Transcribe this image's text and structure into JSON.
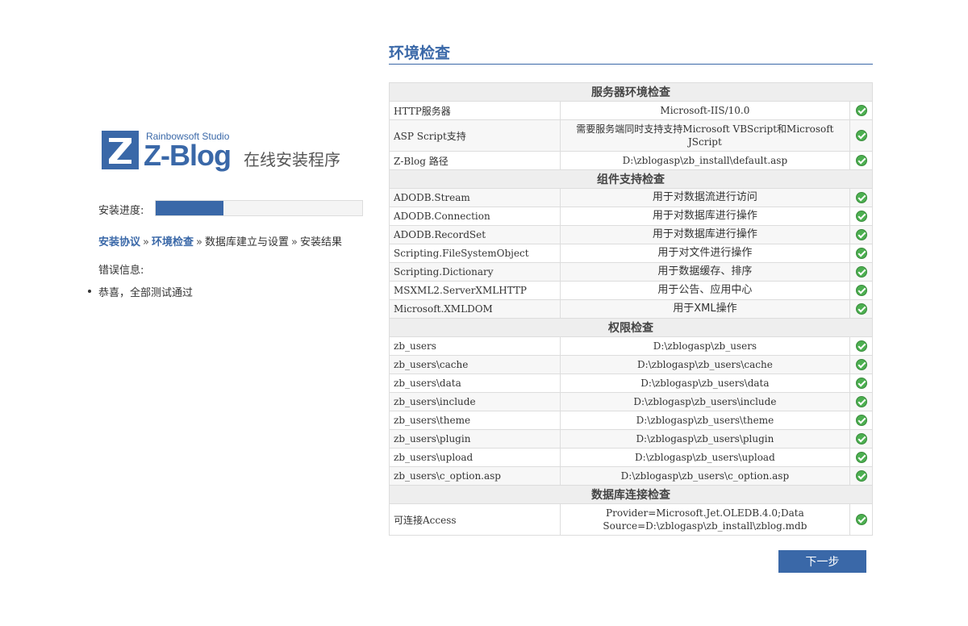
{
  "logo": {
    "studio": "Rainbowsoft Studio",
    "brand": "Z-Blog",
    "subtitle": "在线安装程序"
  },
  "progress": {
    "label": "安装进度:",
    "percent": 33
  },
  "steps": [
    {
      "label": "安装协议",
      "done": true
    },
    {
      "label": "环境检查",
      "done": true
    },
    {
      "label": "数据库建立与设置",
      "done": false
    },
    {
      "label": "安装结果",
      "done": false
    }
  ],
  "step_separator": "»",
  "error": {
    "label": "错误信息:",
    "messages": [
      "恭喜，全部测试通过"
    ]
  },
  "page_title": "环境检查",
  "sections": [
    {
      "title": "服务器环境检查",
      "rows": [
        {
          "name": "HTTP服务器",
          "value": "Microsoft-IIS/10.0",
          "status": "ok"
        },
        {
          "name": "ASP Script支持",
          "value": "需要服务端同时支持支持Microsoft VBScript和Microsoft JScript",
          "status": "ok"
        },
        {
          "name": "Z-Blog 路径",
          "value": "D:\\zblogasp\\zb_install\\default.asp",
          "status": "ok"
        }
      ]
    },
    {
      "title": "组件支持检查",
      "rows": [
        {
          "name": "ADODB.Stream",
          "value": "用于对数据流进行访问",
          "status": "ok"
        },
        {
          "name": "ADODB.Connection",
          "value": "用于对数据库进行操作",
          "status": "ok"
        },
        {
          "name": "ADODB.RecordSet",
          "value": "用于对数据库进行操作",
          "status": "ok"
        },
        {
          "name": "Scripting.FileSystemObject",
          "value": "用于对文件进行操作",
          "status": "ok"
        },
        {
          "name": "Scripting.Dictionary",
          "value": "用于数据缓存、排序",
          "status": "ok"
        },
        {
          "name": "MSXML2.ServerXMLHTTP",
          "value": "用于公告、应用中心",
          "status": "ok"
        },
        {
          "name": "Microsoft.XMLDOM",
          "value": "用于XML操作",
          "status": "ok"
        }
      ]
    },
    {
      "title": "权限检查",
      "rows": [
        {
          "name": "zb_users",
          "value": "D:\\zblogasp\\zb_users",
          "status": "ok"
        },
        {
          "name": "zb_users\\cache",
          "value": "D:\\zblogasp\\zb_users\\cache",
          "status": "ok"
        },
        {
          "name": "zb_users\\data",
          "value": "D:\\zblogasp\\zb_users\\data",
          "status": "ok"
        },
        {
          "name": "zb_users\\include",
          "value": "D:\\zblogasp\\zb_users\\include",
          "status": "ok"
        },
        {
          "name": "zb_users\\theme",
          "value": "D:\\zblogasp\\zb_users\\theme",
          "status": "ok"
        },
        {
          "name": "zb_users\\plugin",
          "value": "D:\\zblogasp\\zb_users\\plugin",
          "status": "ok"
        },
        {
          "name": "zb_users\\upload",
          "value": "D:\\zblogasp\\zb_users\\upload",
          "status": "ok"
        },
        {
          "name": "zb_users\\c_option.asp",
          "value": "D:\\zblogasp\\zb_users\\c_option.asp",
          "status": "ok"
        }
      ]
    },
    {
      "title": "数据库连接检查",
      "rows": [
        {
          "name": "可连接Access",
          "value": "Provider=Microsoft.Jet.OLEDB.4.0;Data Source=D:\\zblogasp\\zb_install\\zblog.mdb",
          "status": "ok"
        }
      ]
    }
  ],
  "status_icon": "check-circle-icon",
  "colors": {
    "accent": "#3a68a8",
    "ok": "#4caf50"
  },
  "next_button": "下一步"
}
